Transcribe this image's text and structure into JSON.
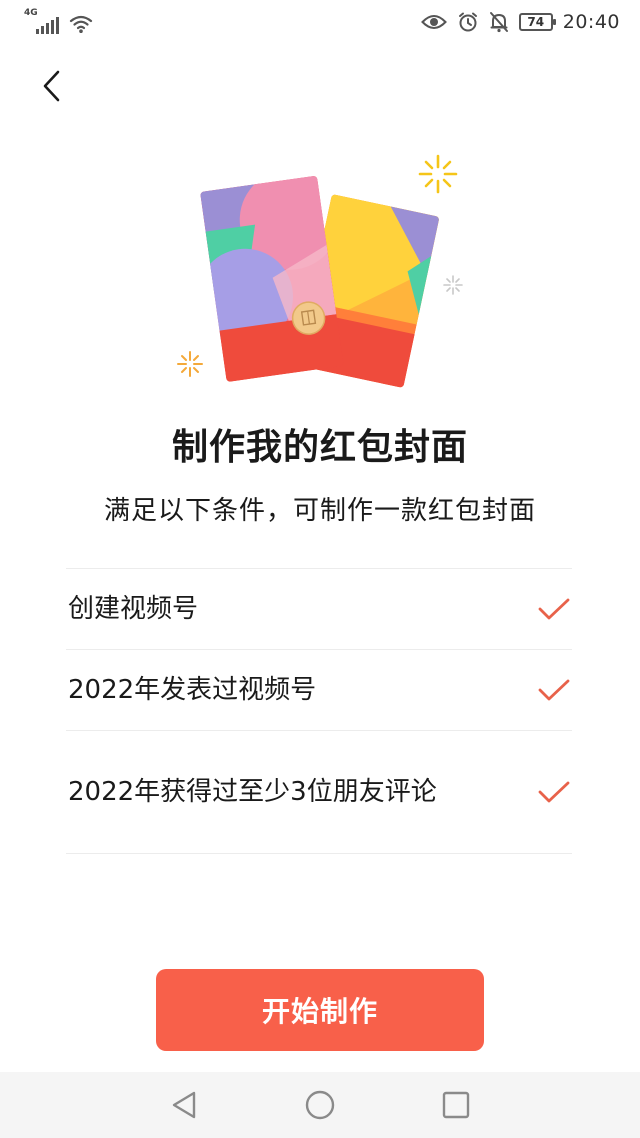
{
  "status_bar": {
    "network": "4G",
    "battery": "74",
    "time": "20:40"
  },
  "header": {
    "back_icon": "chevron-left-icon"
  },
  "title": "制作我的红包封面",
  "subtitle": "满足以下条件，可制作一款红包封面",
  "conditions": [
    {
      "label": "创建视频号",
      "met": true
    },
    {
      "label": "2022年发表过视频号",
      "met": true
    },
    {
      "label": "2022年获得过至少3位朋友评论",
      "met": true
    }
  ],
  "colors": {
    "accent": "#f8604a",
    "check": "#e8624a"
  },
  "start_button": {
    "label": "开始制作"
  },
  "nav_bar": {
    "icons": [
      "triangle-back-icon",
      "circle-home-icon",
      "square-recent-icon"
    ]
  }
}
